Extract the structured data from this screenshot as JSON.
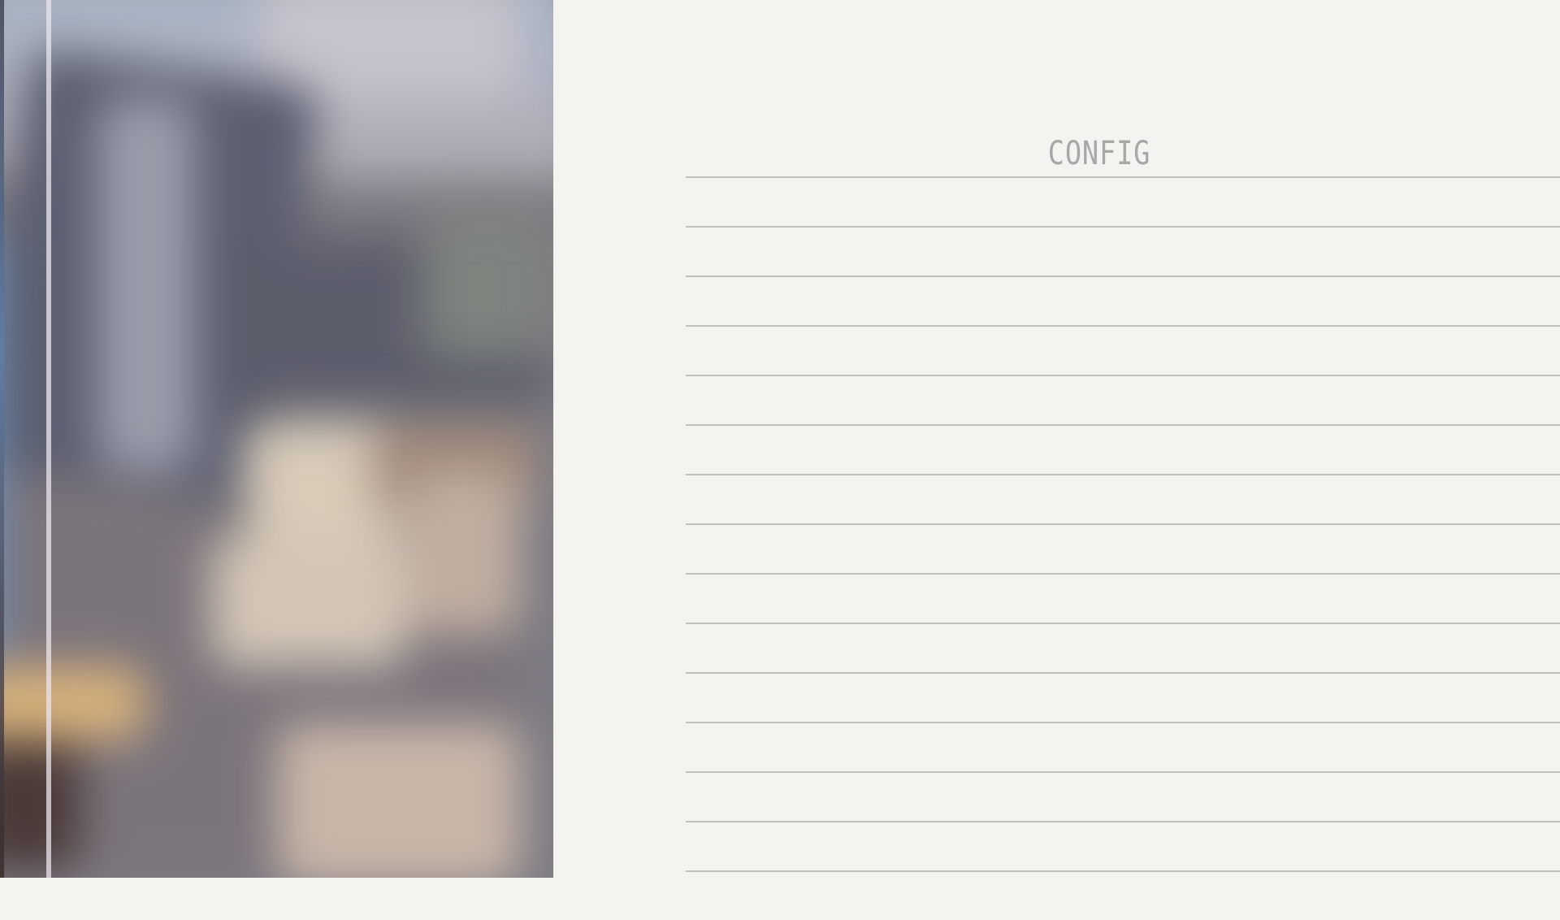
{
  "config": {
    "title": "CONFIG",
    "rows": 15
  },
  "colors": {
    "background": "#f4f3ef",
    "rule": "#c2c0bd",
    "title": "#a9a6a8"
  }
}
